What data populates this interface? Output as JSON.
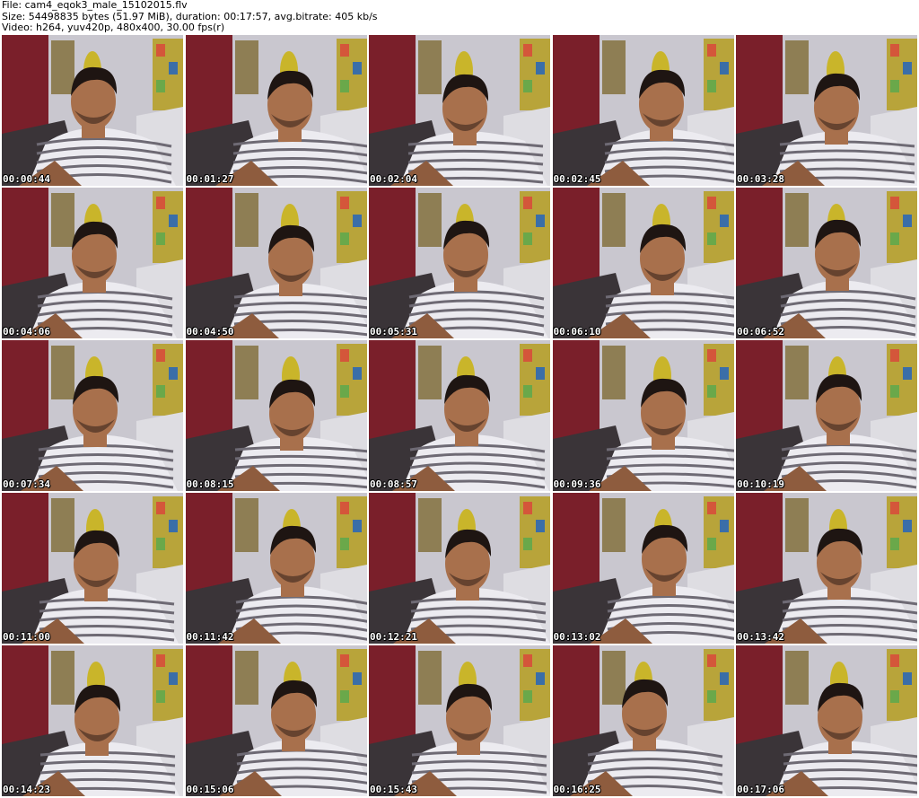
{
  "header": {
    "file_line": "File: cam4_eqok3_male_15102015.flv",
    "size_line": "Size: 54498835 bytes (51.97 MiB), duration: 00:17:57, avg.bitrate: 405 kb/s",
    "video_line": "Video: h264, yuv420p, 480x400, 30.00 fps(r)"
  },
  "colors": {
    "background": "#ffffff",
    "timestamp_text": "#ffffff",
    "timestamp_outline": "#000000",
    "wall": "#c9c7cf",
    "curtain": "#7a1f2a",
    "posters": "#b8a43a",
    "shirt_light": "#ecebf0",
    "shirt_stripe": "#6e6a74",
    "skin": "#a8704c",
    "hair": "#1e1512",
    "chair": "#3a3438"
  },
  "thumbnails": [
    {
      "time": "00:00:44"
    },
    {
      "time": "00:01:27"
    },
    {
      "time": "00:02:04"
    },
    {
      "time": "00:02:45"
    },
    {
      "time": "00:03:28"
    },
    {
      "time": "00:04:06"
    },
    {
      "time": "00:04:50"
    },
    {
      "time": "00:05:31"
    },
    {
      "time": "00:06:10"
    },
    {
      "time": "00:06:52"
    },
    {
      "time": "00:07:34"
    },
    {
      "time": "00:08:15"
    },
    {
      "time": "00:08:57"
    },
    {
      "time": "00:09:36"
    },
    {
      "time": "00:10:19"
    },
    {
      "time": "00:11:00"
    },
    {
      "time": "00:11:42"
    },
    {
      "time": "00:12:21"
    },
    {
      "time": "00:13:02"
    },
    {
      "time": "00:13:42"
    },
    {
      "time": "00:14:23"
    },
    {
      "time": "00:15:06"
    },
    {
      "time": "00:15:43"
    },
    {
      "time": "00:16:25"
    },
    {
      "time": "00:17:06"
    }
  ]
}
